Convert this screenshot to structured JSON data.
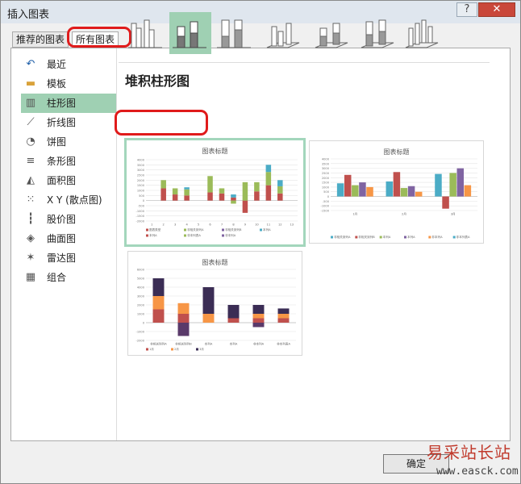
{
  "window": {
    "title": "插入图表",
    "help_label": "?",
    "close_label": "✕"
  },
  "tabs": [
    {
      "label": "推荐的图表"
    },
    {
      "label": "所有图表"
    }
  ],
  "sidebar": {
    "items": [
      {
        "label": "最近",
        "icon": "recent-icon"
      },
      {
        "label": "模板",
        "icon": "folder-icon"
      },
      {
        "label": "柱形图",
        "icon": "column-chart-icon"
      },
      {
        "label": "折线图",
        "icon": "line-chart-icon"
      },
      {
        "label": "饼图",
        "icon": "pie-chart-icon"
      },
      {
        "label": "条形图",
        "icon": "bar-chart-icon"
      },
      {
        "label": "面积图",
        "icon": "area-chart-icon"
      },
      {
        "label": "X Y (散点图)",
        "icon": "scatter-chart-icon"
      },
      {
        "label": "股价图",
        "icon": "stock-chart-icon"
      },
      {
        "label": "曲面图",
        "icon": "surface-chart-icon"
      },
      {
        "label": "雷达图",
        "icon": "radar-chart-icon"
      },
      {
        "label": "组合",
        "icon": "combo-chart-icon"
      }
    ]
  },
  "main": {
    "subtype_heading": "堆积柱形图"
  },
  "colors": {
    "accent_selected": "#9fd0b3",
    "highlight": "#e01b1b"
  },
  "previews": [
    {
      "title": "图表标题",
      "chart_data": {
        "type": "bar",
        "stacked": true,
        "title": "图表标题",
        "categories": [
          "1",
          "2",
          "3",
          "4",
          "5",
          "6",
          "7",
          "8",
          "9",
          "10",
          "11",
          "12",
          "13"
        ],
        "y_ticks": [
          "4000",
          "3500",
          "3000",
          "2500",
          "2000",
          "1500",
          "1000",
          "500",
          "0",
          "-500",
          "-1000",
          "-1500",
          "-2000"
        ],
        "ylim": [
          -2000,
          4000
        ],
        "series": [
          {
            "values": [
              0,
              1200,
              600,
              500,
              0,
              800,
              700,
              300,
              -1200,
              900,
              1500,
              700,
              0
            ],
            "color": "#c0504d"
          },
          {
            "values": [
              0,
              800,
              600,
              600,
              0,
              1600,
              500,
              -300,
              1800,
              900,
              1300,
              700,
              0
            ],
            "color": "#9bbb59"
          },
          {
            "values": [
              0,
              0,
              0,
              0,
              0,
              0,
              0,
              0,
              0,
              0,
              0,
              0,
              0
            ],
            "color": "#8064a2"
          },
          {
            "values": [
              0,
              0,
              0,
              200,
              0,
              0,
              0,
              300,
              0,
              0,
              700,
              600,
              0
            ],
            "color": "#4bacc6"
          }
        ],
        "legend": [
          "图表类型",
          "非相关到列A",
          "非相关到列B",
          "本列A",
          "本列A",
          "非本列表A",
          "非本列A"
        ]
      }
    },
    {
      "title": "图表标题",
      "chart_data": {
        "type": "bar",
        "stacked": false,
        "title": "图表标题",
        "categories": [
          "1月",
          "2月",
          "3月"
        ],
        "y_ticks": [
          "4000",
          "3500",
          "3000",
          "2500",
          "2000",
          "1500",
          "1000",
          "500",
          "0",
          "-500",
          "-1000",
          "-1500"
        ],
        "ylim": [
          -1500,
          4000
        ],
        "series": [
          {
            "values": [
              1400,
              1600,
              2400
            ],
            "color": "#4bacc6"
          },
          {
            "values": [
              2300,
              2600,
              -1300
            ],
            "color": "#c0504d"
          },
          {
            "values": [
              1200,
              900,
              2500
            ],
            "color": "#9bbb59"
          },
          {
            "values": [
              1500,
              1100,
              3000
            ],
            "color": "#8064a2"
          },
          {
            "values": [
              1000,
              500,
              1200
            ],
            "color": "#f79646"
          }
        ],
        "legend": [
          "非相关到列A",
          "非相关到列B",
          "本列A",
          "本列A",
          "非本列A",
          "非本列表A"
        ]
      }
    },
    {
      "title": "图表标题",
      "chart_data": {
        "type": "bar",
        "stacked": true,
        "title": "图表标题",
        "categories": [
          "非相关到列A",
          "非相关到列B",
          "本列A",
          "本列A",
          "非本列A",
          "非本列表A"
        ],
        "y_ticks": [
          "6000",
          "5000",
          "4000",
          "3000",
          "2000",
          "1000",
          "0",
          "-1000",
          "-2000"
        ],
        "ylim": [
          -2000,
          6000
        ],
        "series": [
          {
            "name": "1月",
            "values": [
              1500,
              1000,
              0,
              500,
              500,
              500
            ],
            "color": "#c0504d"
          },
          {
            "name": "2月",
            "values": [
              1500,
              1200,
              1000,
              0,
              500,
              500
            ],
            "color": "#f79646"
          },
          {
            "name": "3月",
            "values": [
              2000,
              0,
              3000,
              1500,
              1000,
              600
            ],
            "color": "#3b2d55"
          },
          {
            "name": "",
            "values": [
              0,
              -1500,
              0,
              0,
              -500,
              0
            ],
            "color": "#5a3a6a"
          },
          {
            "name": "",
            "values": [
              0,
              0,
              0,
              0,
              0,
              0
            ],
            "color": "#9bbb59"
          }
        ],
        "legend": [
          "1月",
          "2月",
          "3月"
        ]
      }
    }
  ],
  "footer": {
    "ok_label": "确定"
  },
  "watermark": {
    "line1": "易采站长站",
    "line2": "www.easck.com"
  }
}
